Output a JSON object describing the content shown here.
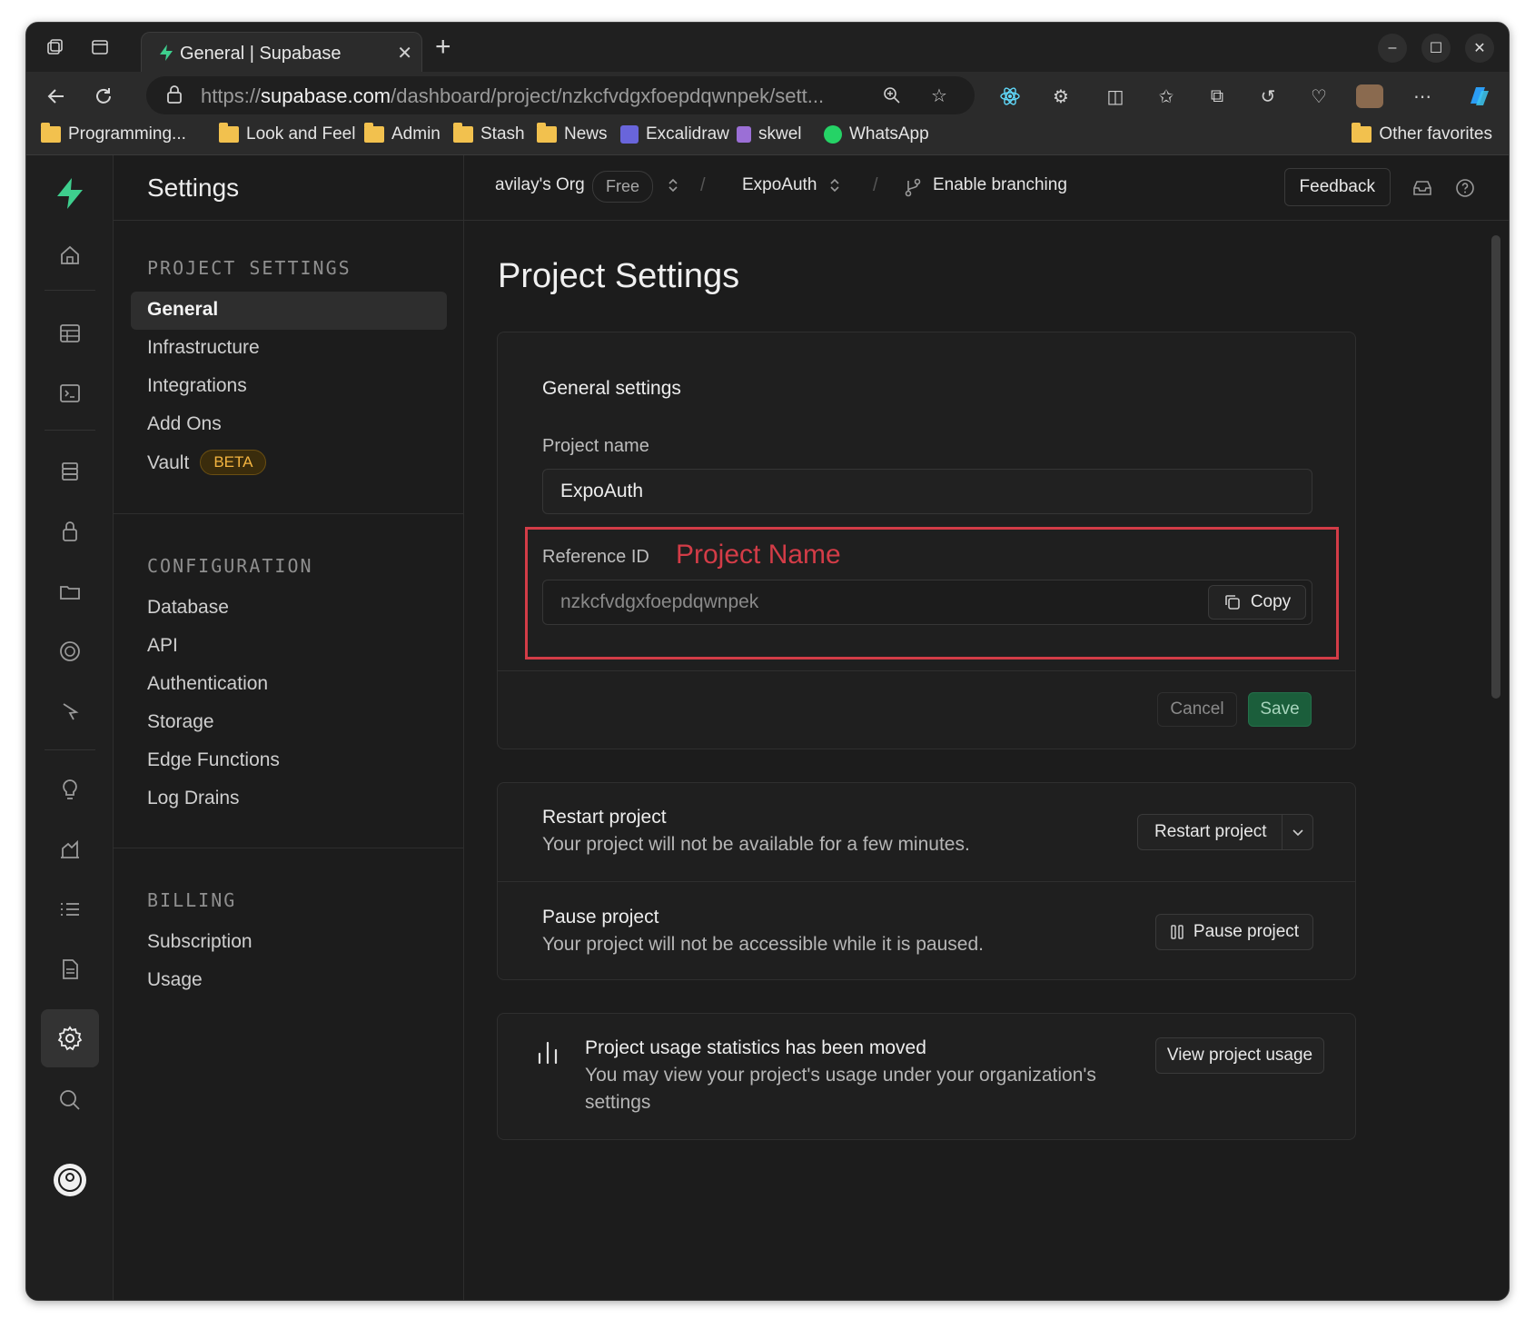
{
  "browser": {
    "tab_title": "General | Supabase",
    "url_prefix": "https://",
    "url_domain": "supabase.com",
    "url_path": "/dashboard/project/nzkcfvdgxfoepdqwnpek/sett...",
    "bookmarks": [
      "Programming...",
      "Look and Feel",
      "Admin",
      "Stash",
      "News",
      "Excalidraw",
      "skwel",
      "WhatsApp"
    ],
    "other_favorites": "Other favorites"
  },
  "sidebar": {
    "title": "Settings",
    "project_settings_heading": "PROJECT SETTINGS",
    "project_items": [
      "General",
      "Infrastructure",
      "Integrations",
      "Add Ons",
      "Vault"
    ],
    "vault_badge": "BETA",
    "configuration_heading": "CONFIGURATION",
    "configuration_items": [
      "Database",
      "API",
      "Authentication",
      "Storage",
      "Edge Functions",
      "Log Drains"
    ],
    "billing_heading": "BILLING",
    "billing_items": [
      "Subscription",
      "Usage"
    ]
  },
  "topbar": {
    "org": "avilay's Org",
    "plan": "Free",
    "project": "ExpoAuth",
    "branching": "Enable branching",
    "feedback": "Feedback"
  },
  "main": {
    "page_title": "Project Settings",
    "general_settings": {
      "heading": "General settings",
      "project_name_label": "Project name",
      "project_name_value": "ExpoAuth",
      "reference_id_label": "Reference ID",
      "annotation": "Project Name",
      "reference_id_value": "nzkcfvdgxfoepdqwnpek",
      "copy": "Copy",
      "cancel": "Cancel",
      "save": "Save"
    },
    "restart": {
      "title": "Restart project",
      "subtitle": "Your project will not be available for a few minutes.",
      "button": "Restart project"
    },
    "pause": {
      "title": "Pause project",
      "subtitle": "Your project will not be accessible while it is paused.",
      "button": "Pause project"
    },
    "usage": {
      "title": "Project usage statistics has been moved",
      "subtitle_line1": "You may view your project's usage under your organization's",
      "subtitle_line2": "settings",
      "button": "View project usage"
    }
  },
  "colors": {
    "brand": "#3ecf8e",
    "annotation_red": "#d33c47",
    "save_green": "#1b5e3b"
  }
}
